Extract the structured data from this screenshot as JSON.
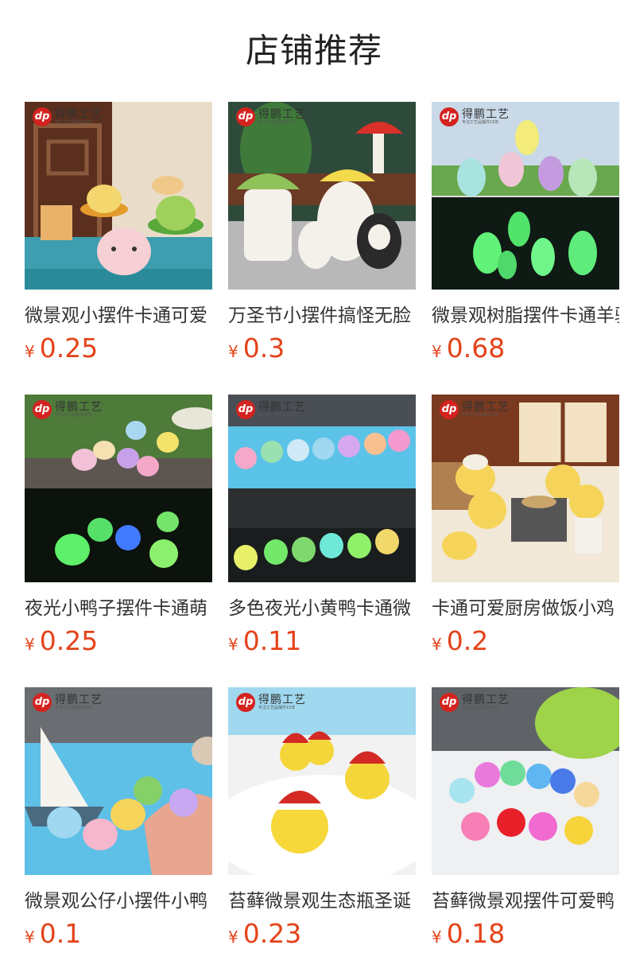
{
  "section_title": "店铺推荐",
  "brand": {
    "badge": "dp",
    "name": "得鹏工艺",
    "tagline": "专注工艺品摆件15年"
  },
  "colors": {
    "price": "#e4431a",
    "title": "#222222"
  },
  "products": [
    {
      "name": "微景观小摆件卡通可爱",
      "currency": "¥",
      "price": "0.25",
      "image": "resin-bun-figurines"
    },
    {
      "name": "万圣节小摆件搞怪无脸",
      "currency": "¥",
      "price": "0.3",
      "image": "ghost-mushroom-house"
    },
    {
      "name": "微景观树脂摆件卡通羊驼",
      "currency": "¥",
      "price": "0.68",
      "image": "glowing-alpacas"
    },
    {
      "name": "夜光小鸭子摆件卡通萌",
      "currency": "¥",
      "price": "0.25",
      "image": "glowing-crown-ducks"
    },
    {
      "name": "多色夜光小黄鸭卡通微",
      "currency": "¥",
      "price": "0.11",
      "image": "multicolor-glow-ducks"
    },
    {
      "name": "卡通可爱厨房做饭小鸡",
      "currency": "¥",
      "price": "0.2",
      "image": "kitchen-chicks"
    },
    {
      "name": "微景观公仔小摆件小鸭",
      "currency": "¥",
      "price": "0.1",
      "image": "beach-ducks"
    },
    {
      "name": "苔藓微景观生态瓶圣诞",
      "currency": "¥",
      "price": "0.23",
      "image": "christmas-ducks"
    },
    {
      "name": "苔藓微景观摆件可爱鸭",
      "currency": "¥",
      "price": "0.18",
      "image": "sunglasses-ducks"
    }
  ]
}
